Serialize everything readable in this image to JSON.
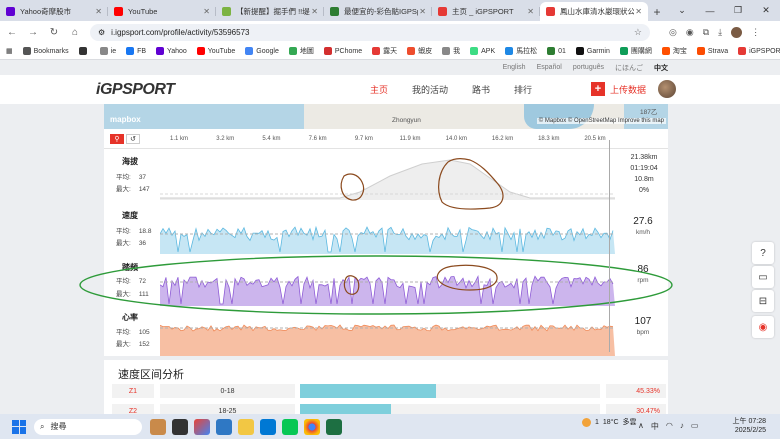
{
  "browser": {
    "tabs": [
      {
        "title": "Yahoo奇摩股市",
        "color": "#6001d2",
        "active": false
      },
      {
        "title": "YouTube",
        "color": "#ff0000",
        "active": false
      },
      {
        "title": "【新提醒】掘手們 !!堤溝...",
        "color": "#7cb342",
        "active": false
      },
      {
        "title": "最便宜的-彩色骷IGPSport...",
        "color": "#2e7d32",
        "active": false
      },
      {
        "title": "主页 _ iGPSPORT",
        "color": "#e53935",
        "active": false
      },
      {
        "title": "鳳山水庫清水巖環狀公園",
        "color": "#e53935",
        "active": true
      }
    ],
    "new_tab": "+",
    "url": "i.igpsport.com/profile/activity/53596573",
    "bookmarks": [
      {
        "label": "Bookmarks",
        "color": "#555"
      },
      {
        "label": "",
        "color": "#333"
      },
      {
        "label": "ie",
        "color": "#888"
      },
      {
        "label": "FB",
        "color": "#1877f2"
      },
      {
        "label": "Yahoo",
        "color": "#6001d2"
      },
      {
        "label": "YouTube",
        "color": "#ff0000"
      },
      {
        "label": "Google",
        "color": "#4285f4"
      },
      {
        "label": "地圖",
        "color": "#34a853"
      },
      {
        "label": "PChome",
        "color": "#d32f2f"
      },
      {
        "label": "露天",
        "color": "#e53935"
      },
      {
        "label": "蝦皮",
        "color": "#ee4d2d"
      },
      {
        "label": "我",
        "color": "#888"
      },
      {
        "label": "APK",
        "color": "#3ddc84"
      },
      {
        "label": "馬拉松",
        "color": "#1e88e5"
      },
      {
        "label": "01",
        "color": "#2e7d32"
      },
      {
        "label": "Garmin",
        "color": "#111"
      },
      {
        "label": "團購網",
        "color": "#0f9d58"
      },
      {
        "label": "淘宝",
        "color": "#ff5000"
      },
      {
        "label": "Strava",
        "color": "#fc4c02"
      },
      {
        "label": "iGPSPORT",
        "color": "#e53935"
      }
    ]
  },
  "site": {
    "languages": [
      "English",
      "Español",
      "português",
      "にほんご",
      "中文"
    ],
    "current_language": "中文",
    "logo": "iGPSPORT",
    "nav": [
      "主页",
      "我的活动",
      "路书",
      "排行"
    ],
    "active_nav": "主页",
    "upload_label": "上传数据",
    "upload_icon": "+"
  },
  "map": {
    "logo": "mapbox",
    "place_label": "Zhongyun",
    "road_label": "187乙",
    "attribution": "© Mapbox © OpenStreetMap Improve this map",
    "distance_ticks": [
      "1.1 km",
      "3.2 km",
      "5.4 km",
      "7.6 km",
      "9.7 km",
      "11.9 km",
      "14.0 km",
      "16.2 km",
      "18.3 km",
      "20.5 km"
    ]
  },
  "summary": {
    "distance": "21.38km",
    "duration": "01:19:04",
    "elevation": "10.8m",
    "grade": "0%"
  },
  "metrics": {
    "altitude": {
      "label": "海拔",
      "avg_label": "平均:",
      "avg": "37",
      "max_label": "最大:",
      "max": "147",
      "color": "#c8c8c8"
    },
    "speed": {
      "label": "速度",
      "avg_label": "平均:",
      "avg": "18.8",
      "max_label": "最大:",
      "max": "36",
      "value": "27.6",
      "unit": "km/h",
      "color": "#5bb8e0"
    },
    "cadence": {
      "label": "踏頻",
      "avg_label": "平均:",
      "avg": "72",
      "max_label": "最大:",
      "max": "111",
      "value": "86",
      "unit": "rpm",
      "color": "#8e5cd6"
    },
    "heart": {
      "label": "心率",
      "avg_label": "平均:",
      "avg": "105",
      "max_label": "最大:",
      "max": "152",
      "value": "107",
      "unit": "bpm",
      "color": "#f08a58"
    }
  },
  "zones": {
    "title": "速度区间分析",
    "rows": [
      {
        "zone": "Z1",
        "range": "0-18",
        "percent": "45.33%",
        "fraction": 0.4533
      },
      {
        "zone": "Z2",
        "range": "18-25",
        "percent": "30.47%",
        "fraction": 0.3047
      }
    ]
  },
  "sidebar_icons": [
    "question-icon",
    "chat-icon",
    "book-icon",
    "app-icon"
  ],
  "taskbar": {
    "search_placeholder": "搜尋",
    "weather_temp": "18°C",
    "weather_desc": "多雲",
    "weather_badge": "1",
    "time": "上午 07:28",
    "date": "2025/2/25"
  }
}
